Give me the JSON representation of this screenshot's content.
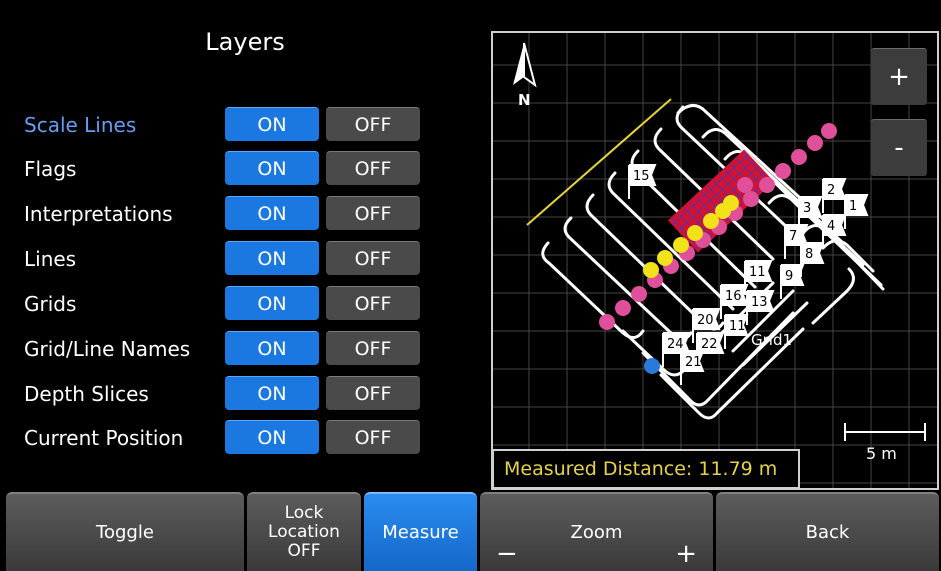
{
  "layers": {
    "title": "Layers",
    "on_label": "ON",
    "off_label": "OFF",
    "items": [
      {
        "label": "Scale Lines",
        "state": "ON",
        "highlighted": true
      },
      {
        "label": "Flags",
        "state": "ON"
      },
      {
        "label": "Interpretations",
        "state": "ON"
      },
      {
        "label": "Lines",
        "state": "ON"
      },
      {
        "label": "Grids",
        "state": "ON"
      },
      {
        "label": "Grid/Line Names",
        "state": "ON"
      },
      {
        "label": "Depth Slices",
        "state": "ON"
      },
      {
        "label": "Current Position",
        "state": "ON"
      }
    ]
  },
  "map": {
    "north_label": "N",
    "zoom_in_label": "+",
    "zoom_out_label": "-",
    "measured_distance": "Measured Distance: 11.79 m",
    "scale_label": "5 m",
    "flags": [
      "15",
      "2",
      "3",
      "1",
      "7",
      "4",
      "8",
      "9",
      "11",
      "16",
      "13",
      "20",
      "24",
      "22",
      "21",
      "11"
    ],
    "grid_name": "Grid1",
    "colors": {
      "magenta": "#e0509a",
      "yellow": "#f2e21a",
      "grid_red": "#d8102a",
      "grid_blue": "#2a3cd8",
      "measure_line": "#e5d43a",
      "position": "#2a7ad8"
    }
  },
  "toolbar": {
    "toggle_label": "Toggle",
    "lock_line1": "Lock",
    "lock_line2": "Location",
    "lock_line3": "OFF",
    "measure_label": "Measure",
    "zoom_label": "Zoom",
    "zoom_minus": "−",
    "zoom_plus": "+",
    "back_label": "Back"
  }
}
